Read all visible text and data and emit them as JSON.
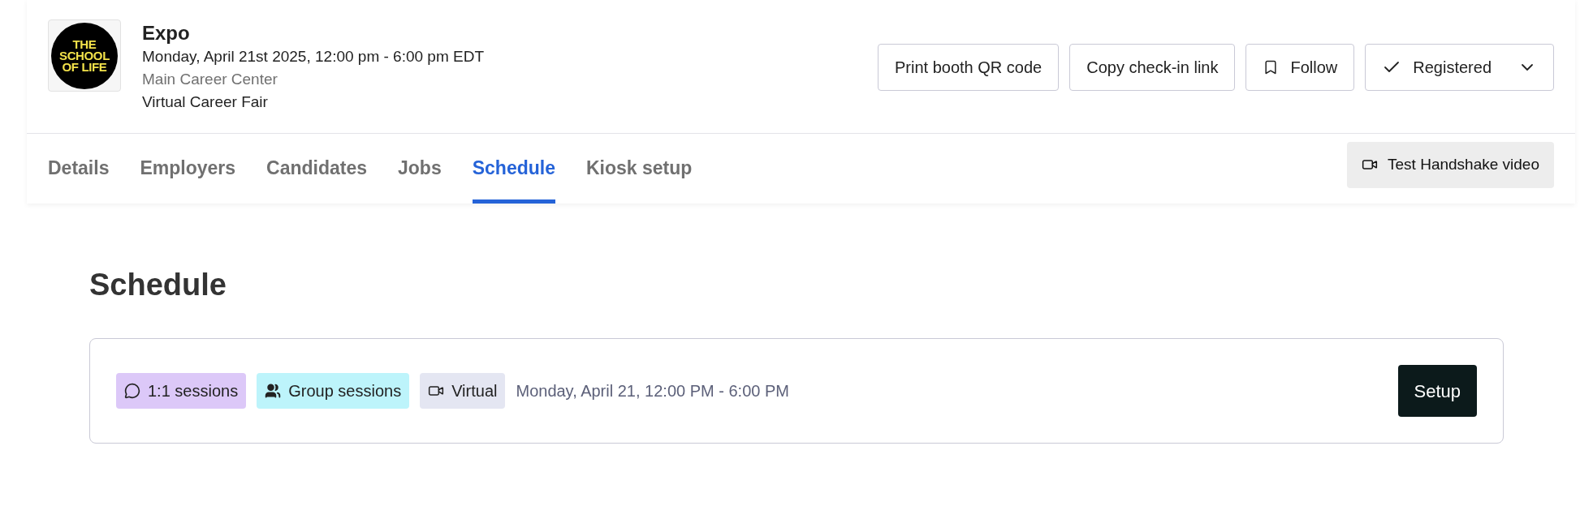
{
  "event": {
    "logo_lines": [
      "THE",
      "SCHOOL",
      "OF LIFE"
    ],
    "title": "Expo",
    "datetime": "Monday, April 21st 2025, 12:00 pm - 6:00 pm EDT",
    "location": "Main Career Center",
    "type": "Virtual Career Fair"
  },
  "actions": [
    {
      "kind": "plain",
      "label": "Print booth QR code"
    },
    {
      "kind": "plain",
      "label": "Copy check-in link"
    },
    {
      "kind": "bookmark",
      "label": "Follow"
    },
    {
      "kind": "status",
      "label": "Registered"
    }
  ],
  "tabs": [
    {
      "label": "Details",
      "selected": false
    },
    {
      "label": "Employers",
      "selected": false
    },
    {
      "label": "Candidates",
      "selected": false
    },
    {
      "label": "Jobs",
      "selected": false
    },
    {
      "label": "Schedule",
      "selected": true
    },
    {
      "label": "Kiosk setup",
      "selected": false
    }
  ],
  "video_button": "Test Handshake video",
  "heading": "Schedule",
  "session": {
    "tags": [
      {
        "kind": "chat",
        "label": "1:1 sessions",
        "color": "#dcc8f8"
      },
      {
        "kind": "group",
        "label": "Group sessions",
        "color": "#bdf4fb"
      },
      {
        "kind": "video",
        "label": "Virtual",
        "color": "#e4e6f2"
      }
    ],
    "time": "Monday, April 21, 12:00 PM - 6:00 PM",
    "button": "Setup"
  }
}
